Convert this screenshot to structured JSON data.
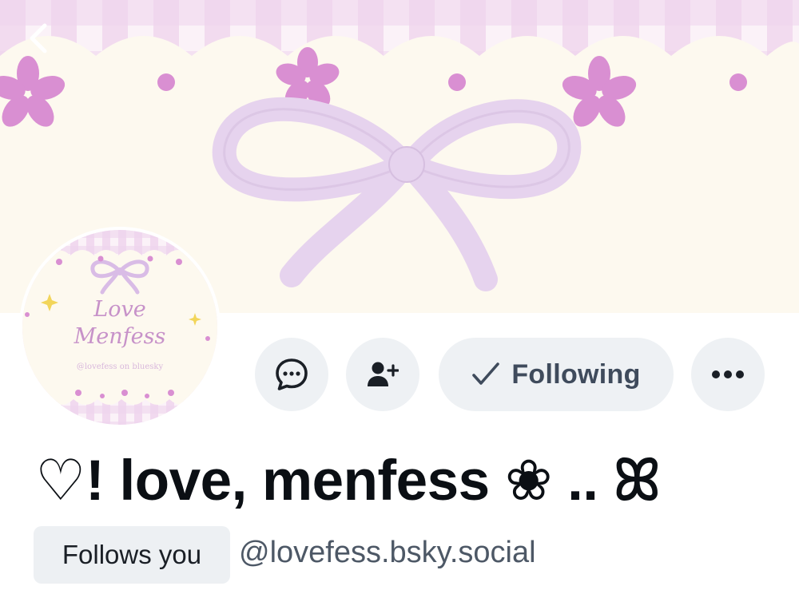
{
  "banner": {
    "alt": "banner image"
  },
  "navigation": {
    "back_icon": "chevron-left-icon"
  },
  "avatar": {
    "title_line1": "Love",
    "title_line2": "Menfess",
    "handle_text": "@lovefess on bluesky"
  },
  "actions": {
    "message_icon": "message-bubble-icon",
    "follow_icon": "person-plus-icon",
    "following_label": "Following",
    "following_icon": "checkmark-icon",
    "more_icon": "ellipsis-icon"
  },
  "profile": {
    "display_name": "♡! love, menfess ❀ .. ⁠ꕤ",
    "follows_you_label": "Follows you",
    "handle": "@lovefess.bsky.social"
  },
  "colors": {
    "banner_pink": "#e9c8ea",
    "flower_pink": "#d98fd2",
    "bow_lilac": "#e6d3ee",
    "banner_cream": "#fdf9ef",
    "button_bg": "#eef1f4",
    "text_primary": "#0b0f14",
    "text_secondary": "#4d5866"
  }
}
